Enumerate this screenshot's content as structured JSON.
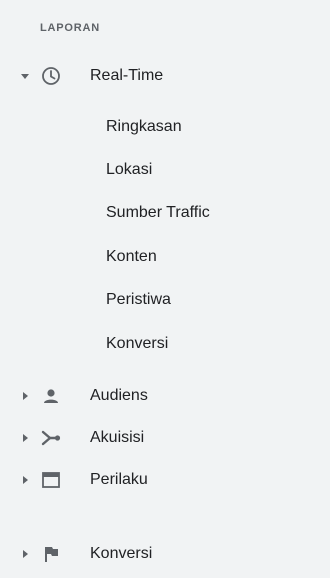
{
  "section": {
    "title": "LAPORAN"
  },
  "realtime": {
    "label": "Real-Time",
    "icon": "clock-icon",
    "expanded": true,
    "children": [
      "Ringkasan",
      "Lokasi",
      "Sumber Traffic",
      "Konten",
      "Peristiwa",
      "Konversi"
    ]
  },
  "items": [
    {
      "label": "Audiens",
      "icon": "person-icon"
    },
    {
      "label": "Akuisisi",
      "icon": "acquisition-icon"
    },
    {
      "label": "Perilaku",
      "icon": "behavior-icon"
    },
    {
      "label": "Konversi",
      "icon": "flag-icon"
    }
  ],
  "colors": {
    "background": "#f1f3f4",
    "text": "#202124",
    "icon": "#5f6368"
  }
}
